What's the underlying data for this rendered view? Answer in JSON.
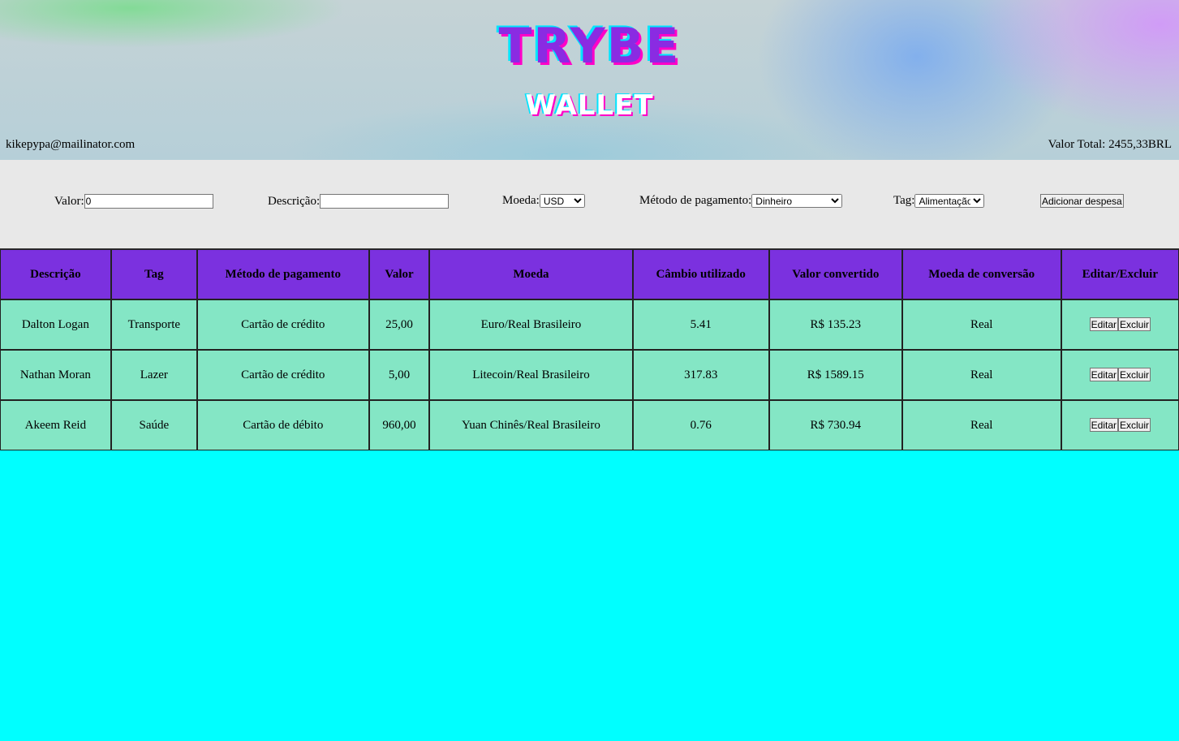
{
  "header": {
    "logo_top": "TRYBE",
    "logo_bottom": "WALLET",
    "email": "kikepypa@mailinator.com",
    "total": "Valor Total: 2455,33BRL"
  },
  "form": {
    "valor_label": "Valor:",
    "valor_value": "0",
    "descricao_label": "Descrição:",
    "descricao_value": "",
    "moeda_label": "Moeda:",
    "moeda_selected": "USD",
    "metodo_label": "Método de pagamento:",
    "metodo_selected": "Dinheiro",
    "tag_label": "Tag:",
    "tag_selected": "Alimentação",
    "add_button": "Adicionar despesa"
  },
  "table": {
    "headers": [
      "Descrição",
      "Tag",
      "Método de pagamento",
      "Valor",
      "Moeda",
      "Câmbio utilizado",
      "Valor convertido",
      "Moeda de conversão",
      "Editar/Excluir"
    ],
    "edit_label": "Editar",
    "delete_label": "Excluir",
    "rows": [
      [
        "Dalton Logan",
        "Transporte",
        "Cartão de crédito",
        "25,00",
        "Euro/Real Brasileiro",
        "5.41",
        "R$ 135.23",
        "Real"
      ],
      [
        "Nathan Moran",
        "Lazer",
        "Cartão de crédito",
        "5,00",
        "Litecoin/Real Brasileiro",
        "317.83",
        "R$ 1589.15",
        "Real"
      ],
      [
        "Akeem Reid",
        "Saúde",
        "Cartão de débito",
        "960,00",
        "Yuan Chinês/Real Brasileiro",
        "0.76",
        "R$ 730.94",
        "Real"
      ]
    ]
  },
  "colors": {
    "page_bg": "#00ffff",
    "header_cell_bg": "#7b31df",
    "row_cell_bg": "#84e6c5",
    "form_bg": "#e8e8e8"
  }
}
